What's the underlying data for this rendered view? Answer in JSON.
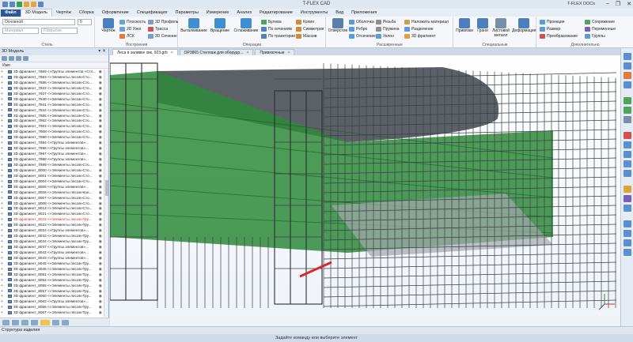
{
  "app": {
    "title": "T-FLEX CAD",
    "account": "T-FLEX DOCs",
    "window_controls": [
      "–",
      "❐",
      "✕"
    ]
  },
  "ribbon_tabs": [
    "Файл",
    "3D Модель",
    "Чертёж",
    "Сборка",
    "Оформление",
    "Спецификация",
    "Параметры",
    "Измерение",
    "Анализ",
    "Редактирование",
    "Инструменты",
    "Вид",
    "Приложения"
  ],
  "ribbon": {
    "style": {
      "layer_value": "Основной",
      "material_placeholder": "Материал",
      "level_placeholder": "Покрытие",
      "level_value": "0",
      "label": "Стиль"
    },
    "build": {
      "sketch": "Чертёж",
      "items": [
        "Плоскость",
        "2D Узел",
        "ЛСК",
        "3D Профиль",
        "Трасса",
        "3D Сечение"
      ],
      "label": "Построения"
    },
    "operations": {
      "big": [
        "Выталкивание",
        "Вращение",
        "Сглаживание"
      ],
      "items": [
        "Булева",
        "По сечениям",
        "По траектории",
        "Копия",
        "Симметрия",
        "Массив"
      ],
      "label": "Операции"
    },
    "advanced": {
      "big": [
        "Отверстие"
      ],
      "items": [
        "Оболочка",
        "Ребро",
        "Отсечение",
        "Резьба",
        "Пружина",
        "Уклон",
        "Наложить материал",
        "Разделение",
        "3D фрагмент"
      ],
      "label": "Расширенные"
    },
    "special": {
      "big": [
        "Привязки",
        "Грани",
        "Листовой металл",
        "Деформация"
      ],
      "label": "Специальные"
    },
    "extra": {
      "items": [
        "Проекция",
        "Размер",
        "Преобразование",
        "Сопряжение",
        "Переменные",
        "Группы"
      ],
      "label": "Дополнительно"
    }
  },
  "left_panel": {
    "title": "3D Модель",
    "controls": "▾ ✕",
    "column_header": "Имя",
    "rows": [
      "3D фрагмент_7869 <«Группы элементов »Сто...",
      "3D фрагмент_7883 <«Элементы лесов»Сто...",
      "3D фрагмент_7886 <«Элементы лесов»Сто...",
      "3D фрагмент_7922 <«Элементы лесов»Сто...",
      "3D фрагмент_7927 <«Элементы лесов»Сто...",
      "3D фрагмент_7940 <«Элементы лесов»Сто...",
      "3D фрагмент_7941 <«Элементы лесов»Сто...",
      "3D фрагмент_7944 <«Элементы лесов»Сто...",
      "3D фрагмент_7955 <«Элементы лесов»Сто...",
      "3D фрагмент_7962 <«Элементы лесов»Сто...",
      "3D фрагмент_7963 <«Элементы лесов»Сто...",
      "3D фрагмент_7968 <«Элементы лесов»Сто...",
      "3D фрагмент_7980 <«Элементы лесов»Сто...",
      "3D фрагмент_7984 <«Группы элементов»...",
      "3D фрагмент_7986 <«Группы элементов»...",
      "3D фрагмент_7987 <«Группы элементов»...",
      "3D фрагмент_7988 <«Группы элементов»...",
      "3D фрагмент_7989 <«Элементы лесов»Сто...",
      "3D фрагмент_8000 <«Элементы лесов»Сто...",
      "3D фрагмент_8001 <«Элементы лесов»Сто...",
      "3D фрагмент_8004 <«Элементы лесов»Сто...",
      "3D фрагмент_8005 <«Группы элементов»...",
      "3D фрагмент_8006 <«Элементы лесов»Кон...",
      "3D фрагмент_8007 <«Элементы лесов»Сто...",
      "3D фрагмент_8008 <«Элементы лесов»Сто...",
      "3D фрагмент_8012 <«Элементы лесов»Сто...",
      "3D фрагмент_8021 <«Элементы лесов»Сто...",
      "3D фрагмент_8022 <«Элементы лесов»Тру...",
      "3D фрагмент_8023 <«Элементы лесов»Тру...",
      "3D фрагмент_8024 <«Группы элементов»...",
      "3D фрагмент_8033 <«Элементы лесов»Тру...",
      "3D фрагмент_8034 <«Элементы лесов»Тру...",
      "3D фрагмент_8037 <«Группы элементов»...",
      "3D фрагмент_8042 <«Группы элементов»...",
      "3D фрагмент_8043 <«Группы элементов»...",
      "3D фрагмент_8045 <«Элементы лесов»Тру...",
      "3D фрагмент_8046 <«Элементы лесов»Тру...",
      "3D фрагмент_8051 <«Элементы лесов»Тру...",
      "3D фрагмент_8052 <«Элементы лесов»Тру...",
      "3D фрагмент_8055 <«Элементы лесов»Тру...",
      "3D фрагмент_8057 <«Элементы лесов»Тру...",
      "3D фрагмент_8060 <«Элементы лесов»Тру...",
      "3D фрагмент_8063 <«Группы элементов»...",
      "3D фрагмент_8066 <«Элементы лесов»Тру...",
      "3D фрагмент_8067 <«Элементы лесов»Тру..."
    ],
    "highlighted_row": 27
  },
  "doc_tabs": [
    {
      "label": "Леса в заливке хвк. 923.grb",
      "active": true
    },
    {
      "label": "OP3865 Стеллаж для оборудо...",
      "active": false
    },
    {
      "label": "Привязочные",
      "active": false
    }
  ],
  "bottom_tab": "Структура изделия",
  "status_text": "Задайте команду или выберите элемент",
  "colors": {
    "file_tab": "#2b5797",
    "hull_green": "#2e8a3a",
    "hull_dark": "#5a5f66",
    "scaffold": "#3a3f46",
    "accent_red": "#d42a2a"
  }
}
